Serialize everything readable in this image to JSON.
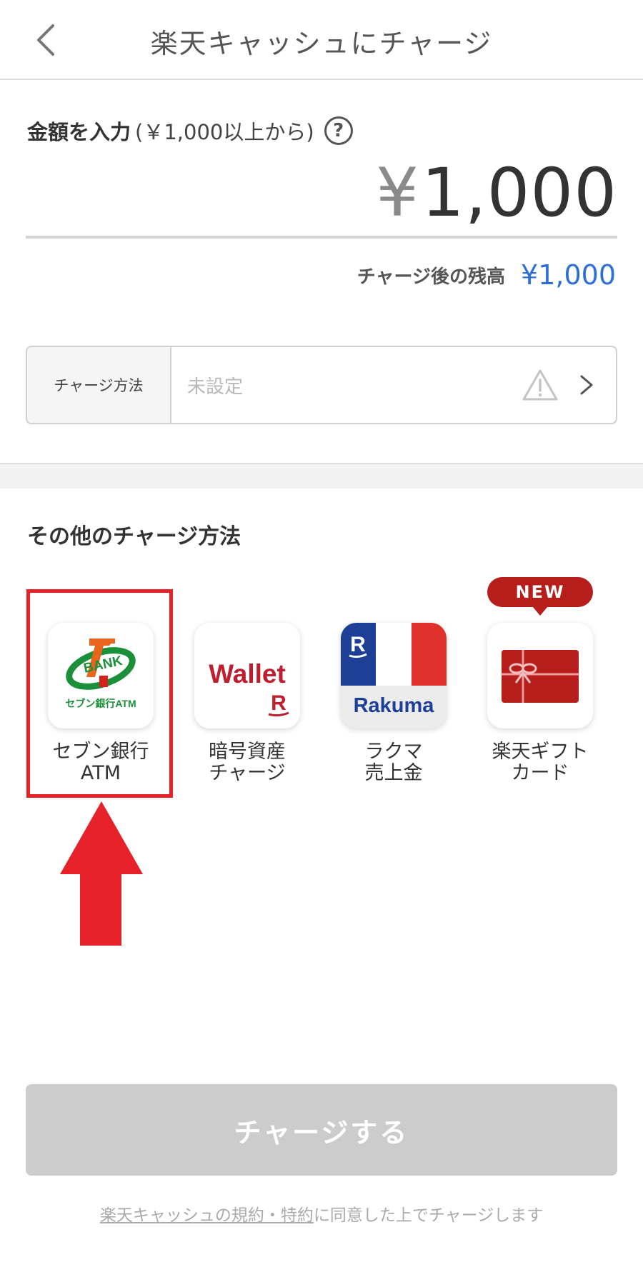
{
  "header": {
    "title": "楽天キャッシュにチャージ"
  },
  "amount": {
    "label": "金額を入力",
    "hint": "(￥1,000以上から)",
    "help_symbol": "?",
    "currency_symbol": "¥",
    "value": "1,000"
  },
  "balance": {
    "label": "チャージ後の残高",
    "value": "¥1,000"
  },
  "charge_method": {
    "label": "チャージ方法",
    "value": "未設定"
  },
  "other_methods": {
    "title": "その他のチャージ方法",
    "badge": "NEW",
    "items": [
      {
        "label": "セブン銀行\nATM",
        "icon": "seven-bank-atm-icon",
        "logo_text": "BANK",
        "logo_sub": "セブン銀行ATM"
      },
      {
        "label": "暗号資産\nチャージ",
        "icon": "rakuten-wallet-icon",
        "logo_text": "Wallet",
        "logo_mark": "R"
      },
      {
        "label": "ラクマ\n売上金",
        "icon": "rakuma-icon",
        "logo_text": "Rakuma",
        "logo_mark": "R"
      },
      {
        "label": "楽天ギフト\nカード",
        "icon": "gift-card-icon"
      }
    ]
  },
  "submit": {
    "label": "チャージする"
  },
  "terms": {
    "link": "楽天キャッシュの規約・特約",
    "text": "に同意した上でチャージします"
  },
  "colors": {
    "accent_blue": "#2e6fd6",
    "highlight_red": "#e62129",
    "badge_red": "#b51e1a",
    "disabled_gray": "#cccccc"
  }
}
